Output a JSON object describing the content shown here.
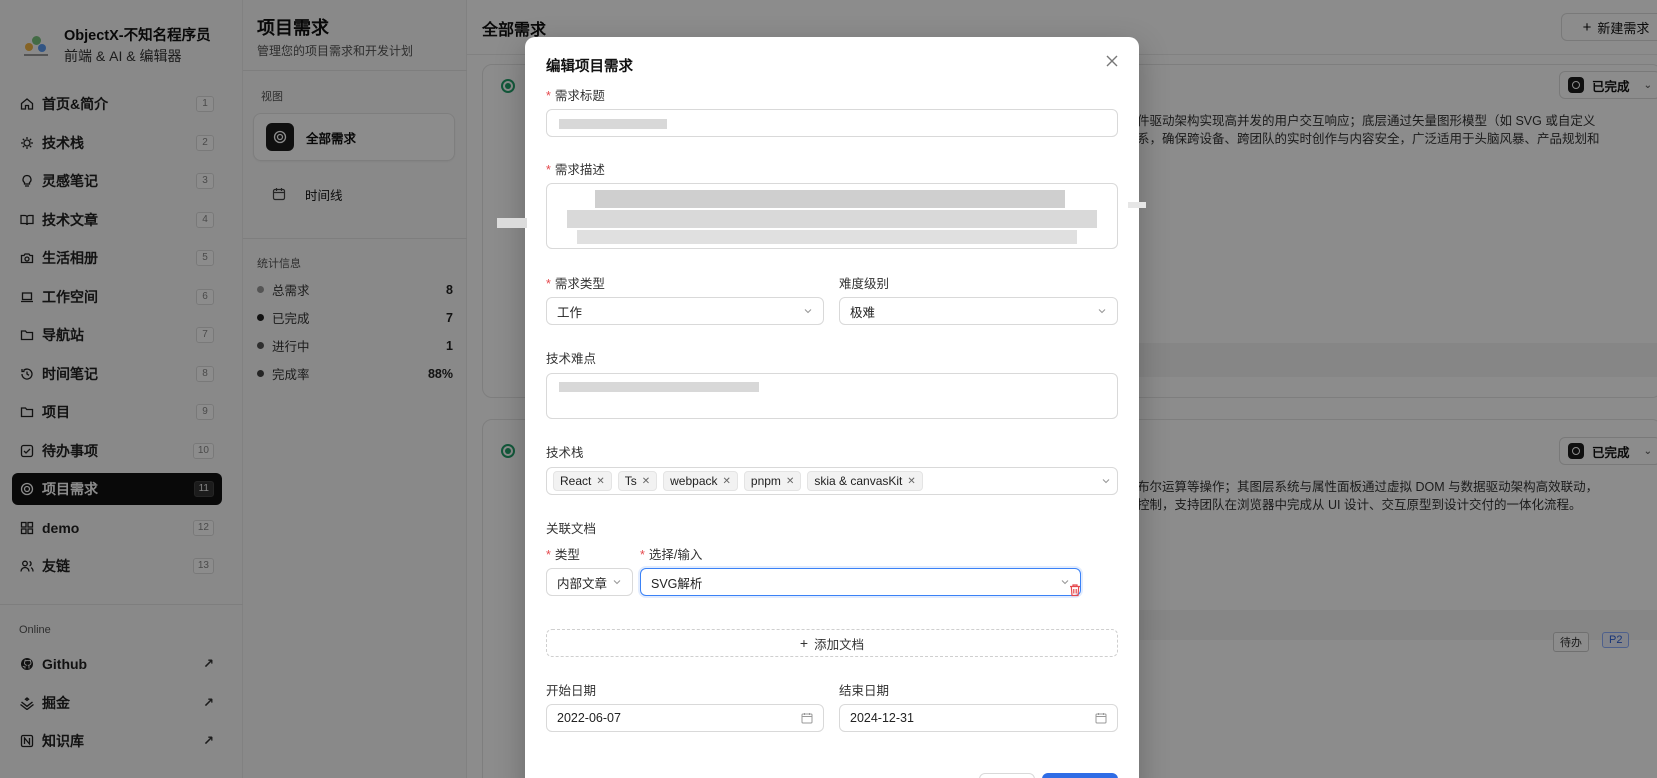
{
  "brand": {
    "name": "ObjectX-不知名程序员",
    "subtitle": "前端 & AI & 编辑器"
  },
  "nav": [
    {
      "label": "首页&简介",
      "num": "1",
      "icon": "home-icon"
    },
    {
      "label": "技术栈",
      "num": "2",
      "icon": "stack-icon"
    },
    {
      "label": "灵感笔记",
      "num": "3",
      "icon": "lightbulb-icon"
    },
    {
      "label": "技术文章",
      "num": "4",
      "icon": "book-icon"
    },
    {
      "label": "生活相册",
      "num": "5",
      "icon": "camera-icon"
    },
    {
      "label": "工作空间",
      "num": "6",
      "icon": "laptop-icon"
    },
    {
      "label": "导航站",
      "num": "7",
      "icon": "folder-icon"
    },
    {
      "label": "时间笔记",
      "num": "8",
      "icon": "history-icon"
    },
    {
      "label": "项目",
      "num": "9",
      "icon": "folder-icon"
    },
    {
      "label": "待办事项",
      "num": "10",
      "icon": "checkbox-icon"
    },
    {
      "label": "项目需求",
      "num": "11",
      "icon": "target-icon",
      "active": true
    },
    {
      "label": "demo",
      "num": "12",
      "icon": "grid-icon"
    },
    {
      "label": "友链",
      "num": "13",
      "icon": "users-icon"
    }
  ],
  "section_online": "Online",
  "links": [
    {
      "label": "Github",
      "icon": "github-icon"
    },
    {
      "label": "掘金",
      "icon": "juejin-icon"
    },
    {
      "label": "知识库",
      "icon": "notion-icon"
    }
  ],
  "middle": {
    "title": "项目需求",
    "subtitle": "管理您的项目需求和开发计划",
    "view_label": "视图",
    "views": [
      "全部需求",
      "时间线"
    ],
    "stats_label": "统计信息",
    "stats": [
      {
        "label": "总需求",
        "value": "8",
        "color": "#9a9a9a"
      },
      {
        "label": "已完成",
        "value": "7",
        "color": "#222222"
      },
      {
        "label": "进行中",
        "value": "1",
        "color": "#555555"
      },
      {
        "label": "完成率",
        "value": "88%",
        "color": "#444444"
      }
    ]
  },
  "main": {
    "title": "全部需求",
    "new_button": "新建需求",
    "cards": [
      {
        "status": "已完成",
        "text_line1": "，采用事件驱动架构实现高并发的用户交互响应；底层通过矢量图形模型（如 SVG 或自定义",
        "text_line2": "与权限体系，确保跨设备、跨团队的实时创作与内容安全，广泛适用于头脑风暴、产品规划和"
      },
      {
        "status": "已完成",
        "text_line1": "经编辑与布尔运算等操作；其图层系统与属性面板通过虚拟 DOM 与数据驱动架构高效联动，",
        "text_line2": "储与权限控制，支持团队在浏览器中完成从 UI 设计、交互原型到设计交付的一体化流程。",
        "badge_todo": "待办",
        "badge_priority": "P2"
      }
    ]
  },
  "modal": {
    "title": "编辑项目需求",
    "title_label": "需求标题",
    "desc_label": "需求描述",
    "type_label": "需求类型",
    "type_value": "工作",
    "difficulty_label": "难度级别",
    "difficulty_value": "极难",
    "challenge_label": "技术难点",
    "stack_label": "技术栈",
    "stack_tags": [
      "React",
      "Ts",
      "webpack",
      "pnpm",
      "skia & canvasKit"
    ],
    "docs_label": "关联文档",
    "doc_type_label": "类型",
    "doc_select_label": "选择/输入",
    "doc_type_value": "内部文章",
    "doc_select_value": "SVG解析",
    "add_doc": "添加文档",
    "start_label": "开始日期",
    "start_value": "2022-06-07",
    "end_label": "结束日期",
    "end_value": "2024-12-31"
  },
  "colors": {
    "accent": "#3b82f6",
    "danger": "#e5484d",
    "success": "#22a06b",
    "dark": "#111111"
  }
}
